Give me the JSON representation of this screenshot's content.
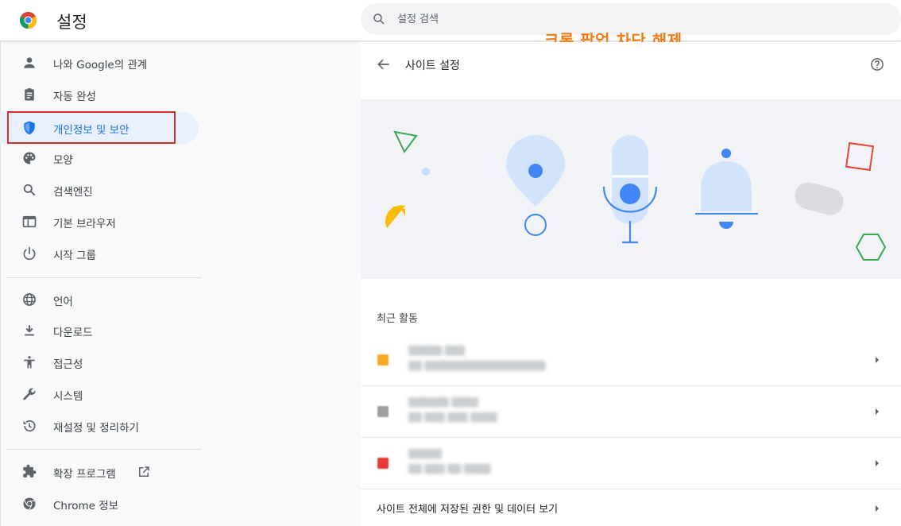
{
  "app": {
    "title": "설정",
    "logo_icon": "chrome-logo-icon"
  },
  "search": {
    "placeholder": "설정 검색",
    "value": ""
  },
  "annotation": {
    "text": "크롬 팝업 차단 해제",
    "color": "#f27b13"
  },
  "sidebar": {
    "items": [
      {
        "label": "나와 Google의 관계",
        "icon": "person-icon"
      },
      {
        "label": "자동 완성",
        "icon": "clipboard-icon"
      },
      {
        "label": "개인정보 및 보안",
        "icon": "shield-icon",
        "active": true
      },
      {
        "label": "모양",
        "icon": "palette-icon"
      },
      {
        "label": "검색엔진",
        "icon": "search-icon"
      },
      {
        "label": "기본 브라우저",
        "icon": "browser-icon"
      },
      {
        "label": "시작 그룹",
        "icon": "power-icon"
      },
      {
        "label": "언어",
        "icon": "globe-icon"
      },
      {
        "label": "다운로드",
        "icon": "download-icon"
      },
      {
        "label": "접근성",
        "icon": "accessibility-icon"
      },
      {
        "label": "시스템",
        "icon": "wrench-icon"
      },
      {
        "label": "재설정 및 정리하기",
        "icon": "history-icon"
      },
      {
        "label": "확장 프로그램",
        "icon": "puzzle-icon"
      },
      {
        "label": "Chrome 정보",
        "icon": "chrome-icon"
      }
    ],
    "active_color": "#1a73e8",
    "highlight_color": "#d93025"
  },
  "main": {
    "title": "사이트 설정",
    "recent_label": "최근 활동",
    "recent_sites": [
      {
        "name": "▒▒▒▒▒ ▒▒▒",
        "desc": "▒▒ ▒▒▒▒▒▒▒▒▒▒▒▒▒▒▒▒▒▒",
        "favicon_color": "#f9a825"
      },
      {
        "name": "▒▒▒▒▒▒ ▒▒▒▒",
        "desc": "▒▒ ▒▒▒ ▒▒▒ ▒▒▒▒",
        "favicon_color": "#9e9e9e"
      },
      {
        "name": "▒▒▒▒▒",
        "desc": "▒▒ ▒▒▒ ▒▒ ▒▒▒▒",
        "favicon_color": "#e53935"
      }
    ],
    "all_sites_label": "사이트 전체에 저장된 권한 및 데이터 보기"
  }
}
